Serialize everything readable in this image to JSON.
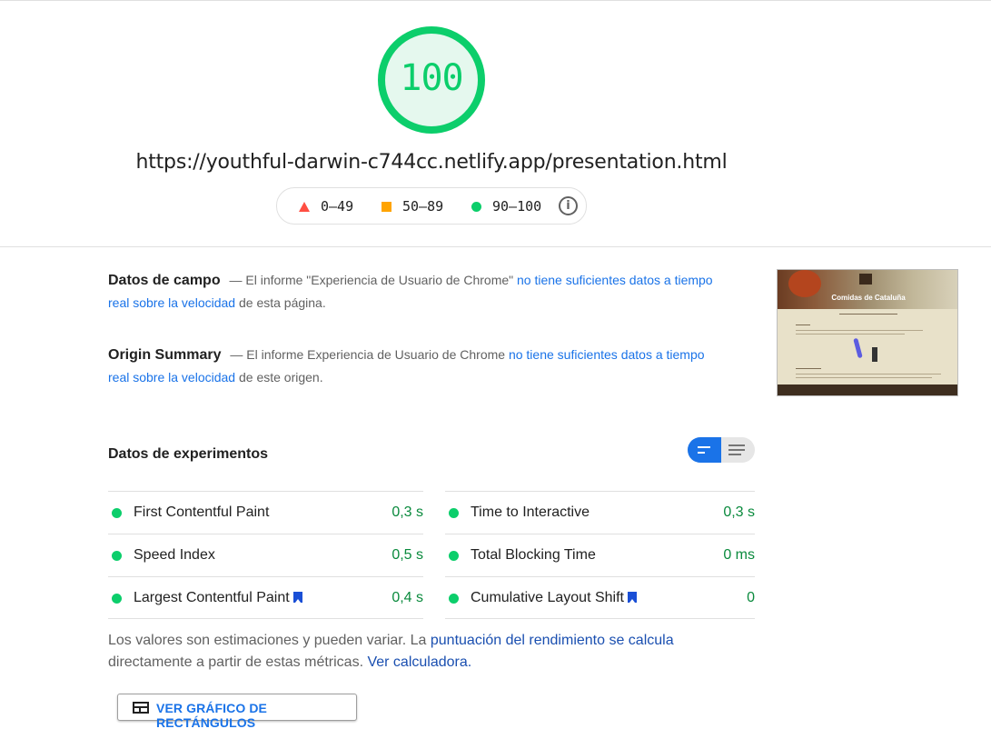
{
  "score": {
    "value": "100",
    "color": "#0cce6b",
    "fill": "#e5f8ee"
  },
  "url": "https://youthful-darwin-c744cc.netlify.app/presentation.html",
  "legend": {
    "fail": "0–49",
    "average": "50–89",
    "pass": "90–100",
    "info_icon": "info-icon"
  },
  "field_data": {
    "title": "Datos de campo",
    "text_before": "— El informe \"Experiencia de Usuario de Chrome\" ",
    "link": "no tiene suficientes datos a tiempo real sobre la velocidad",
    "text_after": " de esta página."
  },
  "origin_summary": {
    "title": "Origin Summary",
    "text_before": "— El informe Experiencia de Usuario de Chrome ",
    "link": "no tiene suficientes datos a tiempo real sobre la velocidad",
    "text_after": " de este origen."
  },
  "screenshot": {
    "site_title": "Comidas de Cataluña"
  },
  "experiments": {
    "title": "Datos de experimentos",
    "metrics": [
      {
        "name": "First Contentful Paint",
        "value": "0,3 s",
        "status": "pass"
      },
      {
        "name": "Time to Interactive",
        "value": "0,3 s",
        "status": "pass"
      },
      {
        "name": "Speed Index",
        "value": "0,5 s",
        "status": "pass"
      },
      {
        "name": "Total Blocking Time",
        "value": "0 ms",
        "status": "pass"
      },
      {
        "name": "Largest Contentful Paint",
        "value": "0,4 s",
        "status": "pass",
        "bookmark": true
      },
      {
        "name": "Cumulative Layout Shift",
        "value": "0",
        "status": "pass",
        "bookmark": true
      }
    ]
  },
  "note": {
    "text_before": "Los valores son estimaciones y pueden variar. La ",
    "link1": "puntuación del rendimiento se calcula",
    "text_middle": " directamente a partir de estas métricas. ",
    "link2": "Ver calculadora."
  },
  "treemap_button": {
    "label": "VER GRÁFICO DE RECTÁNGULOS",
    "icon": "treemap-icon"
  },
  "colors": {
    "pass": "#0cce6b",
    "average": "#ffa400",
    "fail": "#ff4e42",
    "link": "#1a73e8"
  }
}
